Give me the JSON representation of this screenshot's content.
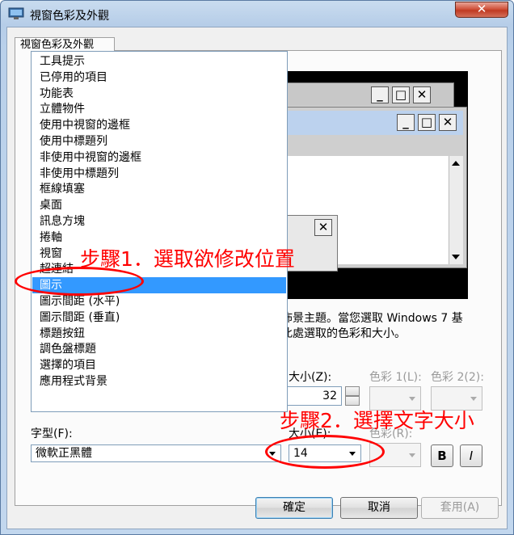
{
  "window": {
    "title": "視窗色彩及外觀",
    "close_label": "✕"
  },
  "tab": {
    "label": "視窗色彩及外觀"
  },
  "item_list": {
    "items": [
      "工具提示",
      "已停用的項目",
      "功能表",
      "立體物件",
      "使用中視窗的邊框",
      "使用中標題列",
      "非使用中視窗的邊框",
      "非使用中標題列",
      "框線填塞",
      "桌面",
      "訊息方塊",
      "捲軸",
      "視窗",
      "超連結",
      "圖示",
      "圖示間距 (水平)",
      "圖示間距 (垂直)",
      "標題按鈕",
      "調色盤標題",
      "選擇的項目",
      "應用程式背景"
    ],
    "selected_index": 14
  },
  "description": {
    "line1": "佈景主題。當您選取 Windows 7 基",
    "line2": "此處選取的色彩和大小。"
  },
  "item_combo": {
    "value": "圖示"
  },
  "size_label": "大小(Z):",
  "size_value": "32",
  "color1_label": "色彩 1(L):",
  "color2_label": "色彩 2(2):",
  "font_label": "字型(F):",
  "font_value": "微軟正黑體",
  "font_size_label": "大小(E):",
  "font_size_value": "14",
  "font_color_label": "色彩(R):",
  "bold_label": "B",
  "italic_label": "I",
  "buttons": {
    "ok": "確定",
    "cancel": "取消",
    "apply": "套用(A)"
  },
  "annotations": {
    "step1": "步驟1．選取欲修改位置",
    "step2": "步驟2．選擇文字大小"
  },
  "colors": {
    "selection": "#3399ff",
    "annotation": "#ff0000"
  },
  "preview": {
    "btn_min": "_",
    "btn_max": "□",
    "btn_close": "✕"
  }
}
